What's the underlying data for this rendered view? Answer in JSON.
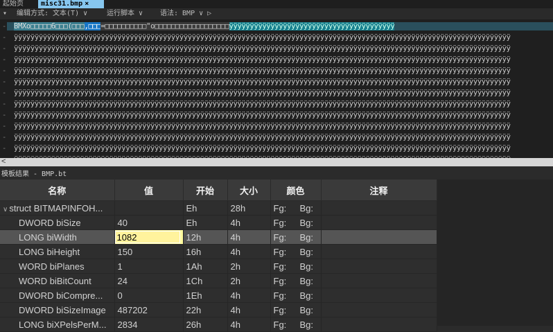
{
  "tabs": {
    "start_label": "起始页",
    "file_label": "misc31.bmp",
    "close_glyph": "×"
  },
  "toolbar": {
    "menu_glyph": "▾",
    "edit_mode": "编辑方式: 文本(T) ∨",
    "run_script": "运行脚本 ∨",
    "syntax": "语法: BMP ∨ ▷"
  },
  "hex_view": {
    "first_row": {
      "seg1": "BMXo□□□□□6□□□(□□□",
      "seg2": ",□□□",
      "seg3": "=□□□□□□□□□□\"o□□□□□□□□□□□□□□□□□□",
      "seg4": "ÿÿÿÿÿÿÿÿÿÿÿÿÿÿÿÿÿÿÿÿÿÿÿÿÿÿÿÿÿÿÿÿÿÿÿÿÿÿÿÿ"
    },
    "row_text": "ÿÿÿÿÿÿÿÿÿÿÿÿÿÿÿÿÿÿÿÿÿÿÿÿÿÿÿÿÿÿÿÿÿÿÿÿÿÿÿÿÿÿÿÿÿÿÿÿÿÿÿÿÿÿÿÿÿÿÿÿÿÿÿÿÿÿÿÿÿÿÿÿÿÿÿÿÿÿÿÿÿÿÿÿÿÿÿÿÿÿÿÿÿÿÿÿÿÿÿÿÿÿÿÿÿÿÿÿÿÿÿÿÿÿÿÿÿÿÿÿ",
    "row_marker": "-",
    "scroll_left_glyph": "<"
  },
  "template_results": {
    "title": "模板结果 - BMP.bt",
    "columns": [
      "名称",
      "值",
      "开始",
      "大小",
      "颜色",
      "注释"
    ],
    "rows": [
      {
        "name": "struct BITMAPINFOH...",
        "value": "",
        "start": "Eh",
        "size": "28h",
        "fg": "Fg:",
        "bg": "Bg:"
      },
      {
        "name": "DWORD biSize",
        "value": "40",
        "start": "Eh",
        "size": "4h",
        "fg": "Fg:",
        "bg": "Bg:"
      },
      {
        "name": "LONG biWidth",
        "value": "1082",
        "start": "12h",
        "size": "4h",
        "fg": "Fg:",
        "bg": "Bg:"
      },
      {
        "name": "LONG biHeight",
        "value": "150",
        "start": "16h",
        "size": "4h",
        "fg": "Fg:",
        "bg": "Bg:"
      },
      {
        "name": "WORD biPlanes",
        "value": "1",
        "start": "1Ah",
        "size": "2h",
        "fg": "Fg:",
        "bg": "Bg:"
      },
      {
        "name": "WORD biBitCount",
        "value": "24",
        "start": "1Ch",
        "size": "2h",
        "fg": "Fg:",
        "bg": "Bg:"
      },
      {
        "name": "DWORD biCompre...",
        "value": "0",
        "start": "1Eh",
        "size": "4h",
        "fg": "Fg:",
        "bg": "Bg:"
      },
      {
        "name": "DWORD biSizeImage",
        "value": "487202",
        "start": "22h",
        "size": "4h",
        "fg": "Fg:",
        "bg": "Bg:"
      },
      {
        "name": "LONG biXPelsPerM...",
        "value": "2834",
        "start": "26h",
        "size": "4h",
        "fg": "Fg:",
        "bg": "Bg:"
      }
    ],
    "struct_caret": "∨"
  }
}
